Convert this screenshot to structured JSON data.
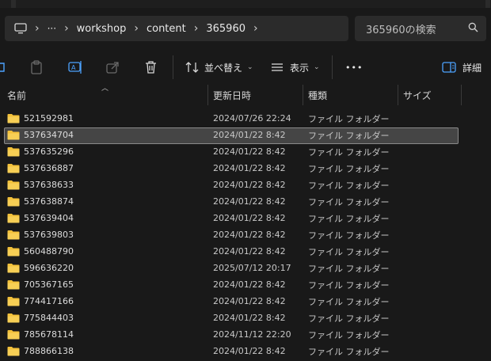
{
  "breadcrumb": {
    "more": "···",
    "items": [
      "workshop",
      "content",
      "365960"
    ]
  },
  "search": {
    "placeholder": "365960の検索"
  },
  "toolbar": {
    "sort_label": "並べ替え",
    "view_label": "表示",
    "more_label": "•••",
    "details_label": "詳細"
  },
  "columns": {
    "name": "名前",
    "date": "更新日時",
    "type": "種類",
    "size": "サイズ"
  },
  "files": [
    {
      "name": "521592981",
      "date": "2024/07/26 22:24",
      "type": "ファイル フォルダー"
    },
    {
      "name": "537634704",
      "date": "2024/01/22 8:42",
      "type": "ファイル フォルダー",
      "selected": true
    },
    {
      "name": "537635296",
      "date": "2024/01/22 8:42",
      "type": "ファイル フォルダー"
    },
    {
      "name": "537636887",
      "date": "2024/01/22 8:42",
      "type": "ファイル フォルダー"
    },
    {
      "name": "537638633",
      "date": "2024/01/22 8:42",
      "type": "ファイル フォルダー"
    },
    {
      "name": "537638874",
      "date": "2024/01/22 8:42",
      "type": "ファイル フォルダー"
    },
    {
      "name": "537639404",
      "date": "2024/01/22 8:42",
      "type": "ファイル フォルダー"
    },
    {
      "name": "537639803",
      "date": "2024/01/22 8:42",
      "type": "ファイル フォルダー"
    },
    {
      "name": "560488790",
      "date": "2024/01/22 8:42",
      "type": "ファイル フォルダー"
    },
    {
      "name": "596636220",
      "date": "2025/07/12 20:17",
      "type": "ファイル フォルダー"
    },
    {
      "name": "705367165",
      "date": "2024/01/22 8:42",
      "type": "ファイル フォルダー"
    },
    {
      "name": "774417166",
      "date": "2024/01/22 8:42",
      "type": "ファイル フォルダー"
    },
    {
      "name": "775844403",
      "date": "2024/01/22 8:42",
      "type": "ファイル フォルダー"
    },
    {
      "name": "785678114",
      "date": "2024/11/12 22:20",
      "type": "ファイル フォルダー"
    },
    {
      "name": "788866138",
      "date": "2024/01/22 8:42",
      "type": "ファイル フォルダー"
    }
  ],
  "icons": {
    "folder": "folder-icon",
    "computer": "computer-icon",
    "search": "search-icon",
    "cut": "cut-icon",
    "paste": "paste-icon",
    "rename": "rename-icon",
    "share": "share-icon",
    "delete": "trash-icon",
    "sort": "sort-icon",
    "view": "view-icon",
    "details": "details-pane-icon"
  },
  "colors": {
    "background": "#191919",
    "folder": "#f3c13a",
    "selection": "#454545"
  }
}
